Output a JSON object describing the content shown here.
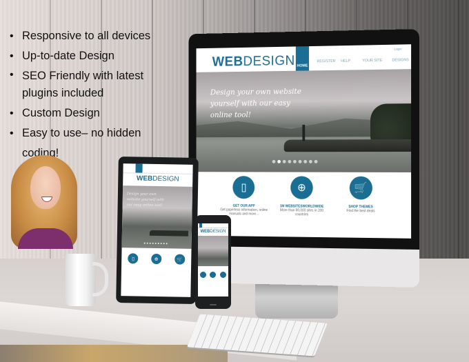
{
  "features": [
    "Responsive to all devices",
    "Up-to-date Design",
    "SEO Friendly with latest plugins included",
    "Custom Design",
    "Easy to use– no hidden coding!"
  ],
  "bullet_glyph": "•",
  "site": {
    "logo_bold": "WEB",
    "logo_light": "DESIGN",
    "login": "Login",
    "nav": [
      "HOME",
      "REGISTER",
      "HELP",
      "YOUR SITE",
      "DESIGNS"
    ],
    "active_nav": "HOME",
    "hero_text": "Design your own website yourself with our easy online tool!",
    "slider_dots": 9,
    "slider_active_index": 1,
    "cards": [
      {
        "icon": "phone-icon",
        "glyph": "▯",
        "title": "GET OUR APP",
        "desc": "Get paperless information, online manuals and more..."
      },
      {
        "icon": "globe-icon",
        "glyph": "⊕",
        "title": "1M WEBSITESWORLDWIDE",
        "desc": "More than 80,000 sites in 200 countries"
      },
      {
        "icon": "cart-icon",
        "glyph": "🛒",
        "title": "SHOP THEMES",
        "desc": "Find the best deals"
      }
    ]
  },
  "colors": {
    "brand_blue": "#1a6d93",
    "text_dark": "#111111"
  }
}
